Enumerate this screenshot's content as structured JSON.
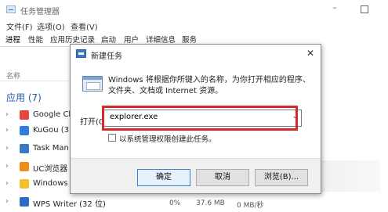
{
  "task_manager": {
    "title": "任务管理器",
    "menu": [
      "文件(F)",
      "选项(O)",
      "查看(V)"
    ],
    "tabs": [
      "进程",
      "性能",
      "应用历史记录",
      "启动",
      "用户",
      "详细信息",
      "服务"
    ],
    "column_name": "名称",
    "group_label": "应用 (7)",
    "apps": [
      {
        "label": "Google Ch",
        "color": "#e8453c"
      },
      {
        "label": "KuGou (3",
        "color": "#2f7de1"
      },
      {
        "label": "Task Man",
        "color": "#3a78c2"
      },
      {
        "label": "UC浏览器",
        "color": "#f08c1c"
      },
      {
        "label": "Windows",
        "color": "#f2c12e"
      },
      {
        "label": "WPS Writer (32 位)",
        "color": "#2b6cc4"
      }
    ],
    "row_values": [
      "0%",
      "37.6 MB",
      "0 MB/秒"
    ]
  },
  "run_dialog": {
    "title": "新建任务",
    "close_glyph": "✕",
    "description_line1": "Windows 将根据你所键入的名称，为你打开相应的程序、",
    "description_line2": "文件夹、文档或 Internet 资源。",
    "open_label": "打开(O",
    "open_value": "explorer.exe",
    "admin_checkbox_label": "以系统管理权限创建此任务。",
    "buttons": {
      "ok": "确定",
      "cancel": "取消",
      "browse": "浏览(B)..."
    },
    "highlight_color": "#d8282a"
  }
}
